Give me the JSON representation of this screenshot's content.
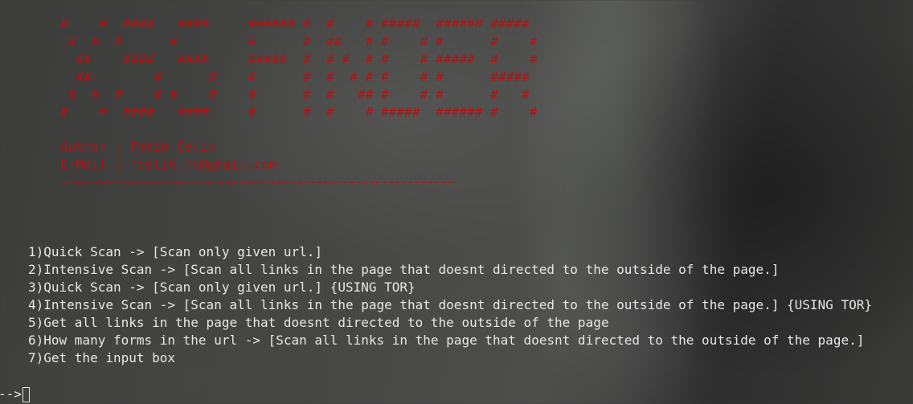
{
  "banner": {
    "lines": [
      "#    #  ####   ####     ###### #  #    # #####  ###### #####",
      " #  #  #      #         #      #  ##   # #    # #      #    #",
      "  ##    ####   ####     #####  #  # #  # #    # #####  #    #",
      "  ##        #      #    #      #  #  # # #    # #      #####",
      " #  #  #    # #    #    #      #  #   ## #    # #      #   #",
      "#    #  ####   ####     #      #  #    # #####  ###### #    #"
    ]
  },
  "author": {
    "author_line": "Author : Fatih Çelik",
    "email_line": "E-Mail : fcelik.ft@gmail.com",
    "separator": "------------------------------------------------------------"
  },
  "menu": {
    "items": [
      "1)Quick Scan -> [Scan only given url.]",
      "2)Intensive Scan -> [Scan all links in the page that doesnt directed to the outside of the page.]",
      "3)Quick Scan -> [Scan only given url.] {USING TOR}",
      "4)Intensive Scan -> [Scan all links in the page that doesnt directed to the outside of the page.] {USING TOR}",
      "5)Get all links in the page that doesnt directed to the outside of the page",
      "6)How many forms in the url -> [Scan all links in the page that doesnt directed to the outside of the page.]",
      "7)Get the input box"
    ]
  },
  "prompt": {
    "symbol": "-->"
  },
  "colors": {
    "banner_red": "#b01414",
    "text": "#e6e6e6"
  }
}
